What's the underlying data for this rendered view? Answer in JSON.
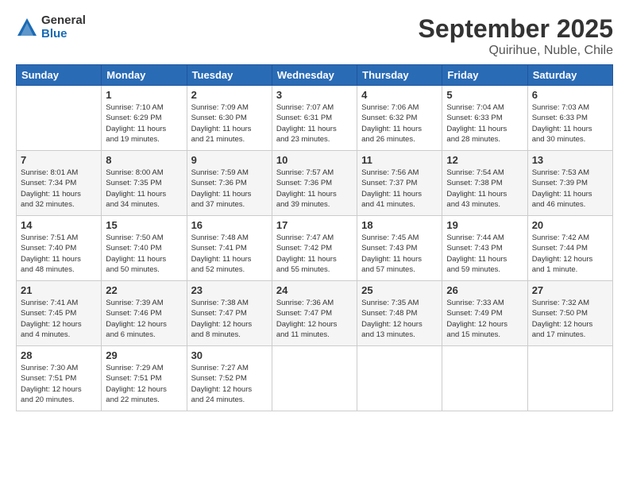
{
  "logo": {
    "general": "General",
    "blue": "Blue"
  },
  "header": {
    "month_title": "September 2025",
    "subtitle": "Quirihue, Nuble, Chile"
  },
  "weekdays": [
    "Sunday",
    "Monday",
    "Tuesday",
    "Wednesday",
    "Thursday",
    "Friday",
    "Saturday"
  ],
  "weeks": [
    [
      {
        "day": "",
        "info": ""
      },
      {
        "day": "1",
        "info": "Sunrise: 7:10 AM\nSunset: 6:29 PM\nDaylight: 11 hours\nand 19 minutes."
      },
      {
        "day": "2",
        "info": "Sunrise: 7:09 AM\nSunset: 6:30 PM\nDaylight: 11 hours\nand 21 minutes."
      },
      {
        "day": "3",
        "info": "Sunrise: 7:07 AM\nSunset: 6:31 PM\nDaylight: 11 hours\nand 23 minutes."
      },
      {
        "day": "4",
        "info": "Sunrise: 7:06 AM\nSunset: 6:32 PM\nDaylight: 11 hours\nand 26 minutes."
      },
      {
        "day": "5",
        "info": "Sunrise: 7:04 AM\nSunset: 6:33 PM\nDaylight: 11 hours\nand 28 minutes."
      },
      {
        "day": "6",
        "info": "Sunrise: 7:03 AM\nSunset: 6:33 PM\nDaylight: 11 hours\nand 30 minutes."
      }
    ],
    [
      {
        "day": "7",
        "info": "Sunrise: 8:01 AM\nSunset: 7:34 PM\nDaylight: 11 hours\nand 32 minutes."
      },
      {
        "day": "8",
        "info": "Sunrise: 8:00 AM\nSunset: 7:35 PM\nDaylight: 11 hours\nand 34 minutes."
      },
      {
        "day": "9",
        "info": "Sunrise: 7:59 AM\nSunset: 7:36 PM\nDaylight: 11 hours\nand 37 minutes."
      },
      {
        "day": "10",
        "info": "Sunrise: 7:57 AM\nSunset: 7:36 PM\nDaylight: 11 hours\nand 39 minutes."
      },
      {
        "day": "11",
        "info": "Sunrise: 7:56 AM\nSunset: 7:37 PM\nDaylight: 11 hours\nand 41 minutes."
      },
      {
        "day": "12",
        "info": "Sunrise: 7:54 AM\nSunset: 7:38 PM\nDaylight: 11 hours\nand 43 minutes."
      },
      {
        "day": "13",
        "info": "Sunrise: 7:53 AM\nSunset: 7:39 PM\nDaylight: 11 hours\nand 46 minutes."
      }
    ],
    [
      {
        "day": "14",
        "info": "Sunrise: 7:51 AM\nSunset: 7:40 PM\nDaylight: 11 hours\nand 48 minutes."
      },
      {
        "day": "15",
        "info": "Sunrise: 7:50 AM\nSunset: 7:40 PM\nDaylight: 11 hours\nand 50 minutes."
      },
      {
        "day": "16",
        "info": "Sunrise: 7:48 AM\nSunset: 7:41 PM\nDaylight: 11 hours\nand 52 minutes."
      },
      {
        "day": "17",
        "info": "Sunrise: 7:47 AM\nSunset: 7:42 PM\nDaylight: 11 hours\nand 55 minutes."
      },
      {
        "day": "18",
        "info": "Sunrise: 7:45 AM\nSunset: 7:43 PM\nDaylight: 11 hours\nand 57 minutes."
      },
      {
        "day": "19",
        "info": "Sunrise: 7:44 AM\nSunset: 7:43 PM\nDaylight: 11 hours\nand 59 minutes."
      },
      {
        "day": "20",
        "info": "Sunrise: 7:42 AM\nSunset: 7:44 PM\nDaylight: 12 hours\nand 1 minute."
      }
    ],
    [
      {
        "day": "21",
        "info": "Sunrise: 7:41 AM\nSunset: 7:45 PM\nDaylight: 12 hours\nand 4 minutes."
      },
      {
        "day": "22",
        "info": "Sunrise: 7:39 AM\nSunset: 7:46 PM\nDaylight: 12 hours\nand 6 minutes."
      },
      {
        "day": "23",
        "info": "Sunrise: 7:38 AM\nSunset: 7:47 PM\nDaylight: 12 hours\nand 8 minutes."
      },
      {
        "day": "24",
        "info": "Sunrise: 7:36 AM\nSunset: 7:47 PM\nDaylight: 12 hours\nand 11 minutes."
      },
      {
        "day": "25",
        "info": "Sunrise: 7:35 AM\nSunset: 7:48 PM\nDaylight: 12 hours\nand 13 minutes."
      },
      {
        "day": "26",
        "info": "Sunrise: 7:33 AM\nSunset: 7:49 PM\nDaylight: 12 hours\nand 15 minutes."
      },
      {
        "day": "27",
        "info": "Sunrise: 7:32 AM\nSunset: 7:50 PM\nDaylight: 12 hours\nand 17 minutes."
      }
    ],
    [
      {
        "day": "28",
        "info": "Sunrise: 7:30 AM\nSunset: 7:51 PM\nDaylight: 12 hours\nand 20 minutes."
      },
      {
        "day": "29",
        "info": "Sunrise: 7:29 AM\nSunset: 7:51 PM\nDaylight: 12 hours\nand 22 minutes."
      },
      {
        "day": "30",
        "info": "Sunrise: 7:27 AM\nSunset: 7:52 PM\nDaylight: 12 hours\nand 24 minutes."
      },
      {
        "day": "",
        "info": ""
      },
      {
        "day": "",
        "info": ""
      },
      {
        "day": "",
        "info": ""
      },
      {
        "day": "",
        "info": ""
      }
    ]
  ]
}
